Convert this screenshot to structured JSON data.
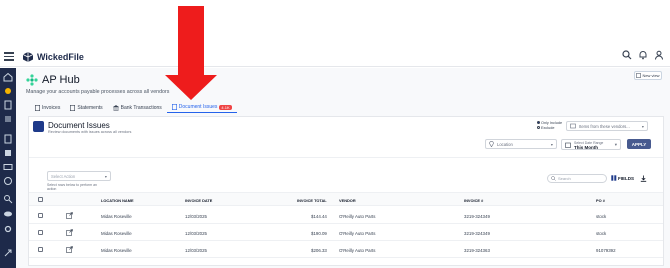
{
  "app": {
    "name": "WickedFile"
  },
  "hub": {
    "title": "AP Hub",
    "subtitle": "Manage your accounts payable processes across all vendors",
    "new_view_label": "New view"
  },
  "tabs": [
    {
      "label": "Invoices"
    },
    {
      "label": "Statements"
    },
    {
      "label": "Bank Transactions"
    },
    {
      "label": "Document Issues",
      "badge": "4.1K"
    }
  ],
  "section": {
    "title": "Document Issues",
    "subtitle": "Review documents with issues across all vendors",
    "radio_include": "Only Include",
    "radio_exclude": "Exclude",
    "vendor_placeholder": "Items from these vendors...",
    "location_placeholder": "Location",
    "date_range_label": "Select Date Range",
    "date_range_value": "This Month",
    "apply_label": "APPLY"
  },
  "toolbar": {
    "select_action_placeholder": "Select Action",
    "select_hint": "Select rows below to perform an action",
    "search_placeholder": "Search",
    "fields_label": "FIELDS"
  },
  "table": {
    "columns": [
      "LOCATION NAME",
      "INVOICE DATE",
      "INVOICE TOTAL",
      "VENDOR",
      "INVOICE #",
      "PO #"
    ],
    "rows": [
      {
        "location": "Midas Roseville",
        "date": "12/03/2025",
        "total": "$144.44",
        "vendor": "O'Reilly Auto Parts",
        "invoice": "3219-324349",
        "po": "stock"
      },
      {
        "location": "Midas Roseville",
        "date": "12/03/2025",
        "total": "$190.09",
        "vendor": "O'Reilly Auto Parts",
        "invoice": "3219-324349",
        "po": "stock"
      },
      {
        "location": "Midas Roseville",
        "date": "12/03/2025",
        "total": "$206.33",
        "vendor": "O'Reilly Auto Parts",
        "invoice": "3219-324363",
        "po": "91079392"
      }
    ]
  },
  "colors": {
    "sidebar": "#1e2a4a",
    "accent": "#2563eb",
    "apply": "#475a8f",
    "arrow": "#ee1c1c"
  }
}
